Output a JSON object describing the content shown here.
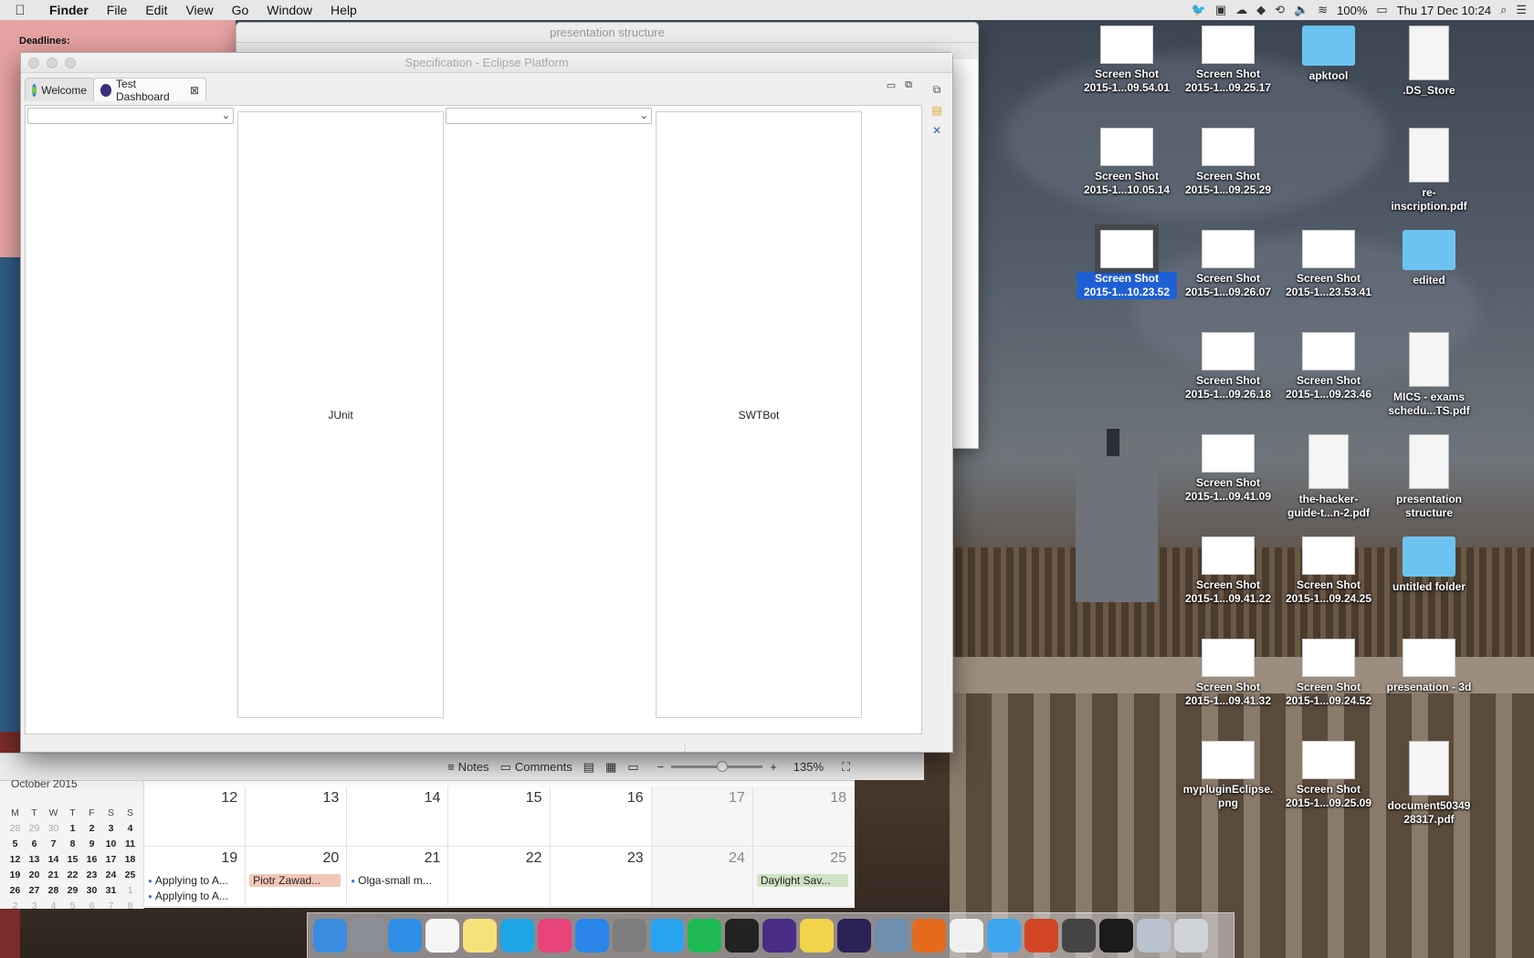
{
  "menubar": {
    "app": "Finder",
    "items": [
      "File",
      "Edit",
      "View",
      "Go",
      "Window",
      "Help"
    ],
    "battery": "100%",
    "clock": "Thu 17 Dec  10:24"
  },
  "background_windows": {
    "doc_title": "presentation structure",
    "deadlines_label": "Deadlines:"
  },
  "eclipse": {
    "title": "Specification - Eclipse Platform",
    "tabs": [
      {
        "label": "Welcome",
        "icon": "welcome-icon"
      },
      {
        "label": "Test Dashboard",
        "icon": "eclipse-icon"
      }
    ],
    "panels": [
      "JUnit",
      "SWTBot"
    ]
  },
  "bottombar": {
    "notes": "Notes",
    "comments": "Comments",
    "zoom": "135%"
  },
  "calendar": {
    "month": "October 2015",
    "weekday_heads": [
      "M",
      "T",
      "W",
      "T",
      "F",
      "S",
      "S"
    ],
    "mini_rows": [
      [
        "28",
        "29",
        "30",
        "1",
        "2",
        "3",
        "4"
      ],
      [
        "5",
        "6",
        "7",
        "8",
        "9",
        "10",
        "11"
      ],
      [
        "12",
        "13",
        "14",
        "15",
        "16",
        "17",
        "18"
      ],
      [
        "19",
        "20",
        "21",
        "22",
        "23",
        "24",
        "25"
      ],
      [
        "26",
        "27",
        "28",
        "29",
        "30",
        "31",
        "1"
      ],
      [
        "2",
        "3",
        "4",
        "5",
        "6",
        "7",
        "8"
      ]
    ],
    "week1": [
      "12",
      "13",
      "14",
      "15",
      "16",
      "17",
      "18"
    ],
    "week2": [
      "19",
      "20",
      "21",
      "22",
      "23",
      "24",
      "25"
    ],
    "events": {
      "mon_1": "Applying to A...",
      "mon_2": "Applying to A...",
      "tue": "Piotr Zawad...",
      "wed": "Olga-small m...",
      "sun": "Daylight Sav..."
    }
  },
  "desktop_icons": [
    {
      "name": "Screen Shot",
      "sub": "2015-1...09.54.01",
      "kind": "thumb"
    },
    {
      "name": "Screen Shot",
      "sub": "2015-1...09.25.17",
      "kind": "thumb"
    },
    {
      "name": "apktool",
      "sub": "",
      "kind": "folder"
    },
    {
      "name": ".DS_Store",
      "sub": "",
      "kind": "doc"
    },
    {
      "name": "Screen Shot",
      "sub": "2015-1...10.05.14",
      "kind": "thumb"
    },
    {
      "name": "Screen Shot",
      "sub": "2015-1...09.25.29",
      "kind": "thumb"
    },
    {
      "name": "re-",
      "sub": "inscription.pdf",
      "kind": "doc"
    },
    {
      "name": "Screen Shot",
      "sub": "2015-1...10.23.52",
      "kind": "thumb"
    },
    {
      "name": "Screen Shot",
      "sub": "2015-1...09.26.07",
      "kind": "thumb"
    },
    {
      "name": "Screen Shot",
      "sub": "2015-1...23.53.41",
      "kind": "thumb"
    },
    {
      "name": "edited",
      "sub": "",
      "kind": "folder"
    },
    {
      "name": "Screen Shot",
      "sub": "2015-1...09.26.18",
      "kind": "thumb"
    },
    {
      "name": "Screen Shot",
      "sub": "2015-1...09.23.46",
      "kind": "thumb"
    },
    {
      "name": "MICS - exams",
      "sub": "schedu...TS.pdf",
      "kind": "doc"
    },
    {
      "name": "Screen Shot",
      "sub": "2015-1...09.41.09",
      "kind": "thumb"
    },
    {
      "name": "the-hacker-",
      "sub": "guide-t...n-2.pdf",
      "kind": "doc"
    },
    {
      "name": "presentation",
      "sub": "structure",
      "kind": "doc"
    },
    {
      "name": "Screen Shot",
      "sub": "2015-1...09.41.22",
      "kind": "thumb"
    },
    {
      "name": "Screen Shot",
      "sub": "2015-1...09.24.25",
      "kind": "thumb"
    },
    {
      "name": "untitled folder",
      "sub": "",
      "kind": "folder"
    },
    {
      "name": "Screen Shot",
      "sub": "2015-1...09.41.32",
      "kind": "thumb"
    },
    {
      "name": "Screen Shot",
      "sub": "2015-1...09.24.52",
      "kind": "thumb"
    },
    {
      "name": "presenation - 3d",
      "sub": "",
      "kind": "thumb"
    },
    {
      "name": "mypluginEclipse.",
      "sub": "png",
      "kind": "thumb"
    },
    {
      "name": "Screen Shot",
      "sub": "2015-1...09.25.09",
      "kind": "thumb"
    },
    {
      "name": "document50349",
      "sub": "28317.pdf",
      "kind": "doc"
    }
  ],
  "dock": [
    {
      "icon": "finder-icon",
      "color": "#3b8be0"
    },
    {
      "icon": "launchpad-icon",
      "color": "#8a8f98"
    },
    {
      "icon": "safari-icon",
      "color": "#2f8fe6"
    },
    {
      "icon": "calendar-icon",
      "color": "#f5f5f5"
    },
    {
      "icon": "notes-icon",
      "color": "#f6e27a"
    },
    {
      "icon": "skype-icon",
      "color": "#1ea5e6"
    },
    {
      "icon": "itunes-icon",
      "color": "#e8427b"
    },
    {
      "icon": "appstore-icon",
      "color": "#2a86e8"
    },
    {
      "icon": "system-preferences-icon",
      "color": "#7d7d7d"
    },
    {
      "icon": "twitter-icon",
      "color": "#2aa3ef"
    },
    {
      "icon": "spotify-icon",
      "color": "#1db954"
    },
    {
      "icon": "terminal-icon",
      "color": "#222222"
    },
    {
      "icon": "texshop-icon",
      "color": "#4a2d86"
    },
    {
      "icon": "stickies-icon",
      "color": "#f2d34a"
    },
    {
      "icon": "eclipse-icon",
      "color": "#2c2256"
    },
    {
      "icon": "preview-icon",
      "color": "#6f8fb0"
    },
    {
      "icon": "firefox-icon",
      "color": "#e66a1c"
    },
    {
      "icon": "textedit-icon",
      "color": "#f0f0f0"
    },
    {
      "icon": "messages-icon",
      "color": "#3ea6ef"
    },
    {
      "icon": "powerpoint-icon",
      "color": "#d24625"
    },
    {
      "icon": "activity-monitor-icon",
      "color": "#444444"
    },
    {
      "icon": "console-icon",
      "color": "#1b1b1b"
    },
    {
      "icon": "downloads-icon",
      "color": "#b9c3cf"
    },
    {
      "icon": "trash-icon",
      "color": "#cfd3d8"
    }
  ]
}
